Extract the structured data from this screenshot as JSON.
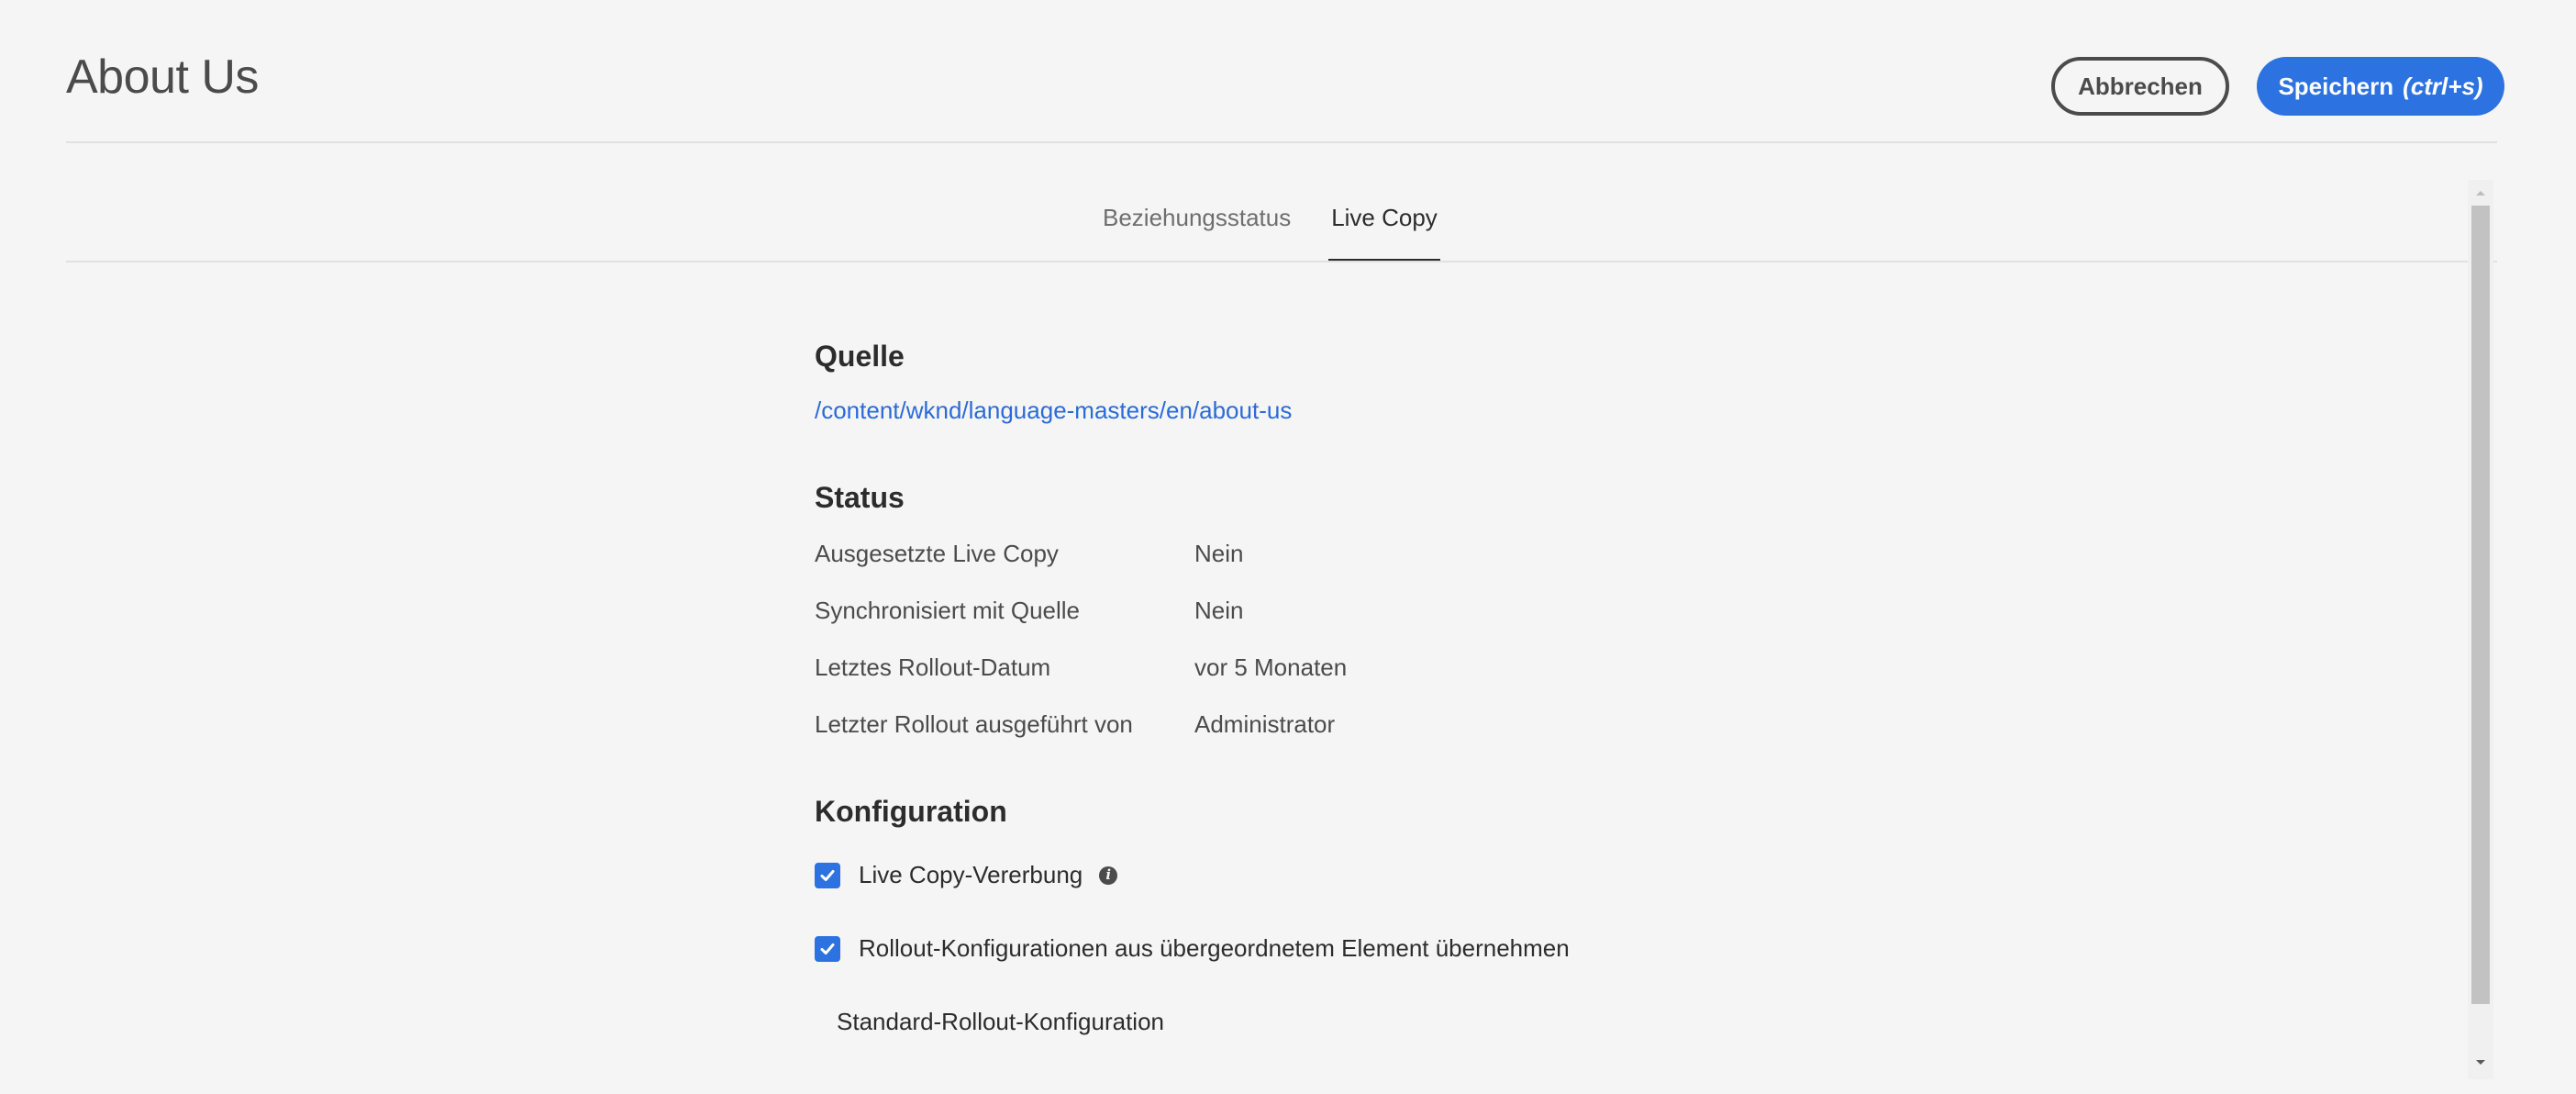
{
  "header": {
    "title": "About Us",
    "cancel_label": "Abbrechen",
    "save_label": "Speichern",
    "save_shortcut": "(ctrl+s)"
  },
  "tabs": [
    {
      "label": "Beziehungsstatus",
      "active": false
    },
    {
      "label": "Live Copy",
      "active": true
    }
  ],
  "source": {
    "heading": "Quelle",
    "path": "/content/wknd/language-masters/en/about-us"
  },
  "status": {
    "heading": "Status",
    "rows": [
      {
        "label": "Ausgesetzte Live Copy",
        "value": "Nein"
      },
      {
        "label": "Synchronisiert mit Quelle",
        "value": "Nein"
      },
      {
        "label": "Letztes Rollout-Datum",
        "value": "vor 5 Monaten"
      },
      {
        "label": "Letzter Rollout ausgeführt von",
        "value": "Administrator"
      }
    ]
  },
  "configuration": {
    "heading": "Konfiguration",
    "inheritance_label": "Live Copy-Vererbung",
    "inheritance_checked": true,
    "inherit_rollout_label": "Rollout-Konfigurationen aus übergeordnetem Element übernehmen",
    "inherit_rollout_checked": true,
    "default_rollout_config": "Standard-Rollout-Konfiguration"
  },
  "colors": {
    "accent": "#2c72e0",
    "link": "#2b6bd6",
    "background": "#f5f5f5"
  },
  "icons": [
    "info-icon",
    "checkmark-icon",
    "chevron-up-icon",
    "chevron-down-icon"
  ]
}
